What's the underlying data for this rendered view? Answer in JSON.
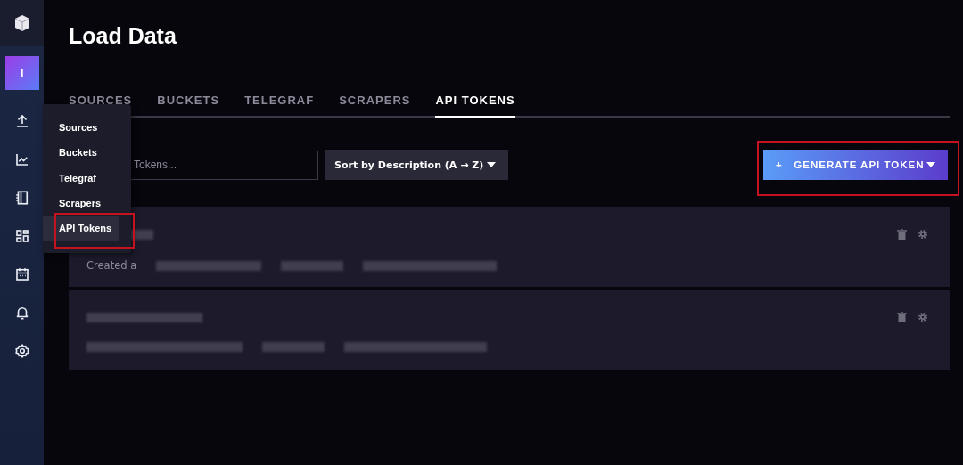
{
  "sidebar": {
    "avatar": "I",
    "popup_menu": [
      {
        "label": "Sources",
        "highlighted": false
      },
      {
        "label": "Buckets",
        "highlighted": false
      },
      {
        "label": "Telegraf",
        "highlighted": false
      },
      {
        "label": "Scrapers",
        "highlighted": false
      },
      {
        "label": "API Tokens",
        "highlighted": true
      }
    ]
  },
  "page": {
    "title": "Load Data"
  },
  "tabs": [
    {
      "label": "SOURCES",
      "selected": false
    },
    {
      "label": "BUCKETS",
      "selected": false
    },
    {
      "label": "TELEGRAF",
      "selected": false
    },
    {
      "label": "SCRAPERS",
      "selected": false
    },
    {
      "label": "API TOKENS",
      "selected": true
    }
  ],
  "search": {
    "placeholder": "Tokens..."
  },
  "sort_dropdown": {
    "label": "Sort by Description (A → Z)"
  },
  "generate_button": {
    "icon": "+",
    "label": "GENERATE API TOKEN",
    "highlighted": true
  },
  "tokens": [
    {
      "kind": "partial",
      "meta": "Created a"
    },
    {
      "kind": "blurred"
    }
  ]
}
